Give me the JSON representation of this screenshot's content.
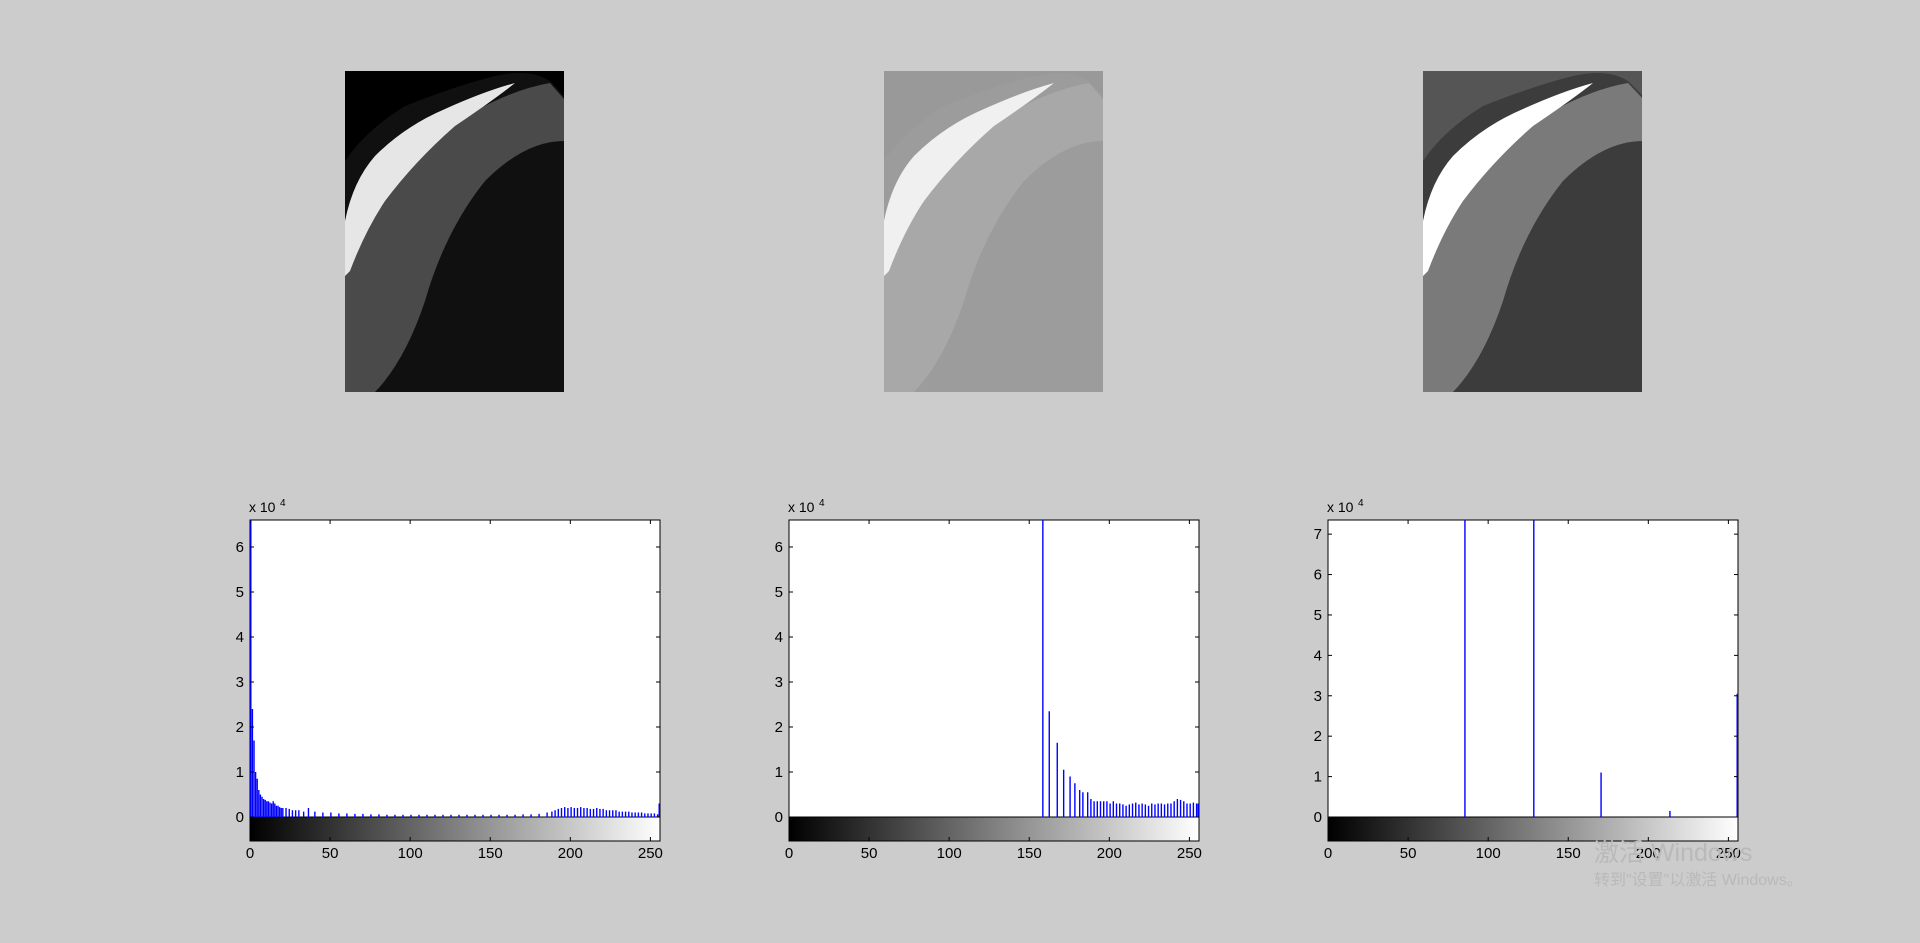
{
  "panels": [
    {
      "tone": "original",
      "bg": "#000000",
      "body_light": "#e6e6e6",
      "body_mid": "#4a4a4a",
      "body_dark": "#101010"
    },
    {
      "tone": "brightened",
      "bg": "#999999",
      "body_light": "#f0f0f0",
      "body_mid": "#a8a8a8",
      "body_dark": "#9c9c9c"
    },
    {
      "tone": "quantized",
      "bg": "#555555",
      "body_light": "#ffffff",
      "body_mid": "#7a7a7a",
      "body_dark": "#3c3c3c"
    }
  ],
  "chart_data": [
    {
      "type": "bar",
      "exponent_base": "x 10",
      "exponent_power": "4",
      "xlim": [
        0,
        256
      ],
      "ylim": [
        0,
        6.6
      ],
      "xticks": [
        "0",
        "50",
        "100",
        "150",
        "200",
        "250"
      ],
      "xtick_values": [
        0,
        50,
        100,
        150,
        200,
        250
      ],
      "yticks": [
        "0",
        "1",
        "2",
        "3",
        "4",
        "5",
        "6"
      ],
      "ytick_values": [
        0,
        1,
        2,
        3,
        4,
        5,
        6
      ],
      "colorbar": true,
      "bar_color": "#0000ff",
      "bins": {
        "x": [
          0,
          1,
          2,
          3,
          4,
          5,
          6,
          7,
          8,
          9,
          10,
          11,
          12,
          13,
          14,
          15,
          16,
          17,
          18,
          19,
          20,
          22,
          24,
          26,
          28,
          30,
          33,
          36,
          40,
          45,
          50,
          55,
          60,
          65,
          70,
          75,
          80,
          85,
          90,
          95,
          100,
          105,
          110,
          115,
          120,
          125,
          130,
          135,
          140,
          145,
          150,
          155,
          160,
          165,
          170,
          175,
          180,
          185,
          188,
          190,
          192,
          194,
          196,
          198,
          200,
          202,
          204,
          206,
          208,
          210,
          212,
          214,
          216,
          218,
          220,
          222,
          224,
          226,
          228,
          230,
          232,
          234,
          236,
          238,
          240,
          242,
          244,
          246,
          248,
          250,
          252,
          254,
          255
        ],
        "y": [
          6.6,
          2.4,
          1.7,
          1.0,
          0.85,
          0.6,
          0.5,
          0.45,
          0.4,
          0.38,
          0.35,
          0.35,
          0.32,
          0.3,
          0.35,
          0.3,
          0.25,
          0.25,
          0.22,
          0.2,
          0.2,
          0.2,
          0.18,
          0.15,
          0.15,
          0.15,
          0.12,
          0.2,
          0.12,
          0.1,
          0.1,
          0.08,
          0.08,
          0.07,
          0.07,
          0.06,
          0.06,
          0.05,
          0.05,
          0.05,
          0.05,
          0.05,
          0.05,
          0.05,
          0.05,
          0.05,
          0.05,
          0.05,
          0.05,
          0.05,
          0.05,
          0.05,
          0.05,
          0.05,
          0.06,
          0.06,
          0.07,
          0.1,
          0.12,
          0.15,
          0.18,
          0.2,
          0.22,
          0.2,
          0.22,
          0.2,
          0.2,
          0.22,
          0.2,
          0.2,
          0.18,
          0.18,
          0.2,
          0.18,
          0.18,
          0.15,
          0.15,
          0.15,
          0.15,
          0.12,
          0.12,
          0.12,
          0.12,
          0.1,
          0.1,
          0.1,
          0.1,
          0.08,
          0.08,
          0.08,
          0.08,
          0.06,
          0.3
        ]
      }
    },
    {
      "type": "bar",
      "exponent_base": "x 10",
      "exponent_power": "4",
      "xlim": [
        0,
        256
      ],
      "ylim": [
        0,
        6.6
      ],
      "xticks": [
        "0",
        "50",
        "100",
        "150",
        "200",
        "250"
      ],
      "xtick_values": [
        0,
        50,
        100,
        150,
        200,
        250
      ],
      "yticks": [
        "0",
        "1",
        "2",
        "3",
        "4",
        "5",
        "6"
      ],
      "ytick_values": [
        0,
        1,
        2,
        3,
        4,
        5,
        6
      ],
      "colorbar": true,
      "bar_color": "#0000ff",
      "bins": {
        "x": [
          158,
          162,
          167,
          171,
          175,
          178,
          181,
          183,
          186,
          188,
          190,
          192,
          194,
          196,
          198,
          200,
          202,
          204,
          206,
          208,
          210,
          212,
          214,
          216,
          218,
          220,
          222,
          224,
          226,
          228,
          230,
          232,
          234,
          236,
          238,
          240,
          242,
          244,
          246,
          248,
          250,
          252,
          254,
          255
        ],
        "y": [
          6.6,
          2.35,
          1.65,
          1.05,
          0.9,
          0.75,
          0.6,
          0.55,
          0.55,
          0.4,
          0.35,
          0.35,
          0.35,
          0.35,
          0.35,
          0.3,
          0.35,
          0.3,
          0.3,
          0.28,
          0.25,
          0.28,
          0.3,
          0.32,
          0.28,
          0.3,
          0.28,
          0.25,
          0.3,
          0.28,
          0.3,
          0.3,
          0.28,
          0.3,
          0.3,
          0.35,
          0.4,
          0.38,
          0.35,
          0.3,
          0.3,
          0.32,
          0.3,
          0.3
        ]
      }
    },
    {
      "type": "bar",
      "exponent_base": "x 10",
      "exponent_power": "4",
      "xlim": [
        0,
        256
      ],
      "ylim": [
        0,
        7.35
      ],
      "xticks": [
        "0",
        "50",
        "100",
        "150",
        "200",
        "250"
      ],
      "xtick_values": [
        0,
        50,
        100,
        150,
        200,
        250
      ],
      "yticks": [
        "0",
        "1",
        "2",
        "3",
        "4",
        "5",
        "6",
        "7"
      ],
      "ytick_values": [
        0,
        1,
        2,
        3,
        4,
        5,
        6,
        7
      ],
      "colorbar": true,
      "bar_color": "#0000ff",
      "bins": {
        "x": [
          85,
          128,
          170,
          213,
          255
        ],
        "y": [
          7.35,
          7.35,
          1.1,
          0.15,
          3.05
        ]
      }
    }
  ],
  "watermark": {
    "line1": "激活 Windows",
    "line2": "转到\"设置\"以激活 Windows。"
  }
}
